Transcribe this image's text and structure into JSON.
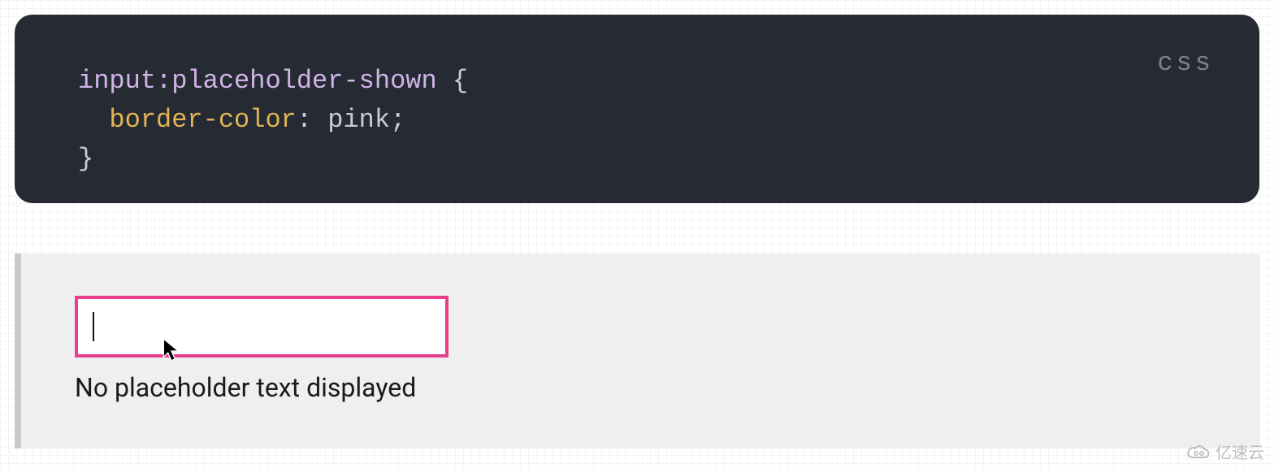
{
  "code": {
    "language": "css",
    "selector": "input:placeholder-shown",
    "open_brace": " {",
    "indent": "  ",
    "property": "border-color",
    "colon_space": ": ",
    "value": "pink",
    "semicolon": ";",
    "close_brace": "}"
  },
  "demo": {
    "input_value": "",
    "caption": "No placeholder text displayed",
    "border_color": "#e83e8c"
  },
  "watermark": {
    "text": "亿速云"
  }
}
